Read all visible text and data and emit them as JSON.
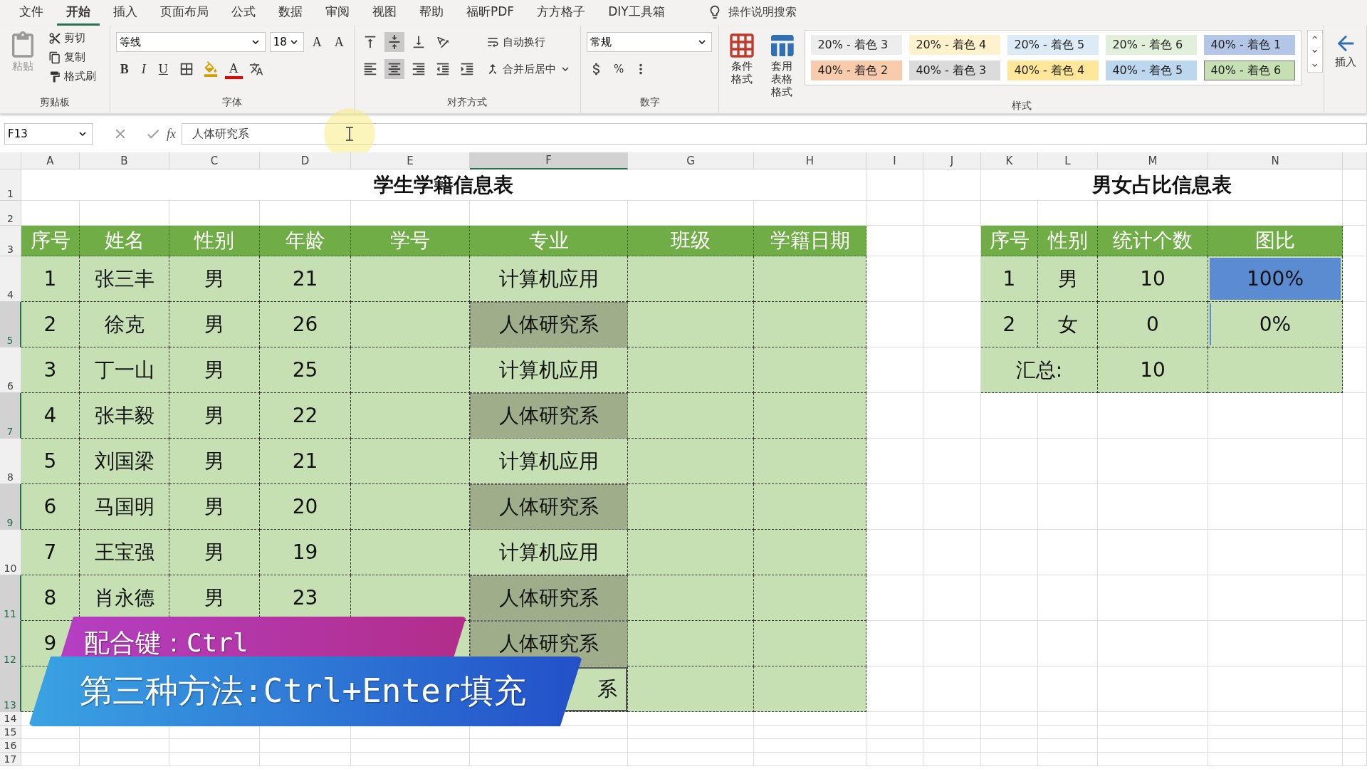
{
  "ribbon_tabs": [
    {
      "label": "文件",
      "selected": false
    },
    {
      "label": "开始",
      "selected": true
    },
    {
      "label": "插入",
      "selected": false
    },
    {
      "label": "页面布局",
      "selected": false
    },
    {
      "label": "公式",
      "selected": false
    },
    {
      "label": "数据",
      "selected": false
    },
    {
      "label": "审阅",
      "selected": false
    },
    {
      "label": "视图",
      "selected": false
    },
    {
      "label": "帮助",
      "selected": false
    },
    {
      "label": "福昕PDF",
      "selected": false
    },
    {
      "label": "方方格子",
      "selected": false
    },
    {
      "label": "DIY工具箱",
      "selected": false
    }
  ],
  "tell_me": "操作说明搜索",
  "clipboard": {
    "paste": "粘贴",
    "cut": "剪切",
    "copy": "复制",
    "format_painter": "格式刷",
    "group": "剪贴板"
  },
  "font": {
    "name": "等线",
    "size": "18",
    "grow": "A",
    "shrink": "A",
    "bold": "B",
    "italic": "I",
    "underline": "U",
    "font_color": "A",
    "group": "字体"
  },
  "alignment": {
    "wrap": "自动换行",
    "merge": "合并后居中",
    "group": "对齐方式"
  },
  "number": {
    "format": "常规",
    "percent": "%",
    "group": "数字"
  },
  "styles": {
    "conditional": "条件格式",
    "table_format_1": "套用",
    "table_format_2": "表格格式",
    "group": "样式",
    "gallery": [
      {
        "label": "20% - 着色 3",
        "color": "#ededed",
        "selected": false
      },
      {
        "label": "20% - 着色 4",
        "color": "#fff2cc",
        "selected": false
      },
      {
        "label": "20% - 着色 5",
        "color": "#ddebf7",
        "selected": false
      },
      {
        "label": "20% - 着色 6",
        "color": "#e2efda",
        "selected": false
      },
      {
        "label": "40% - 着色 1",
        "color": "#b4c6e7",
        "selected": false
      },
      {
        "label": "40% - 着色 2",
        "color": "#f8cbad",
        "selected": false
      },
      {
        "label": "40% - 着色 3",
        "color": "#dbdbdb",
        "selected": false
      },
      {
        "label": "40% - 着色 4",
        "color": "#ffe699",
        "selected": false
      },
      {
        "label": "40% - 着色 5",
        "color": "#bdd7ee",
        "selected": false
      },
      {
        "label": "40% - 着色 6",
        "color": "#c6e0b4",
        "selected": true
      }
    ]
  },
  "cells": {
    "insert": "插入"
  },
  "formula_bar": {
    "name_box": "F13",
    "fx": "fx",
    "formula": "人体研究系"
  },
  "columns": [
    {
      "label": "A",
      "selected": false
    },
    {
      "label": "B",
      "selected": false
    },
    {
      "label": "C",
      "selected": false
    },
    {
      "label": "D",
      "selected": false
    },
    {
      "label": "E",
      "selected": false
    },
    {
      "label": "F",
      "selected": true
    },
    {
      "label": "G",
      "selected": false
    },
    {
      "label": "H",
      "selected": false
    },
    {
      "label": "I",
      "selected": false
    },
    {
      "label": "J",
      "selected": false
    },
    {
      "label": "K",
      "selected": false
    },
    {
      "label": "L",
      "selected": false
    },
    {
      "label": "M",
      "selected": false
    },
    {
      "label": "N",
      "selected": false
    }
  ],
  "row_numbers": [
    {
      "label": "1",
      "selected": false
    },
    {
      "label": "2",
      "selected": false
    },
    {
      "label": "3",
      "selected": false
    },
    {
      "label": "4",
      "selected": false
    },
    {
      "label": "5",
      "selected": true
    },
    {
      "label": "6",
      "selected": false
    },
    {
      "label": "7",
      "selected": true
    },
    {
      "label": "8",
      "selected": false
    },
    {
      "label": "9",
      "selected": true
    },
    {
      "label": "10",
      "selected": false
    },
    {
      "label": "11",
      "selected": true
    },
    {
      "label": "12",
      "selected": true
    },
    {
      "label": "13",
      "selected": true
    },
    {
      "label": "14",
      "selected": false
    },
    {
      "label": "15",
      "selected": false
    },
    {
      "label": "16",
      "selected": false
    },
    {
      "label": "17",
      "selected": false
    }
  ],
  "student_table": {
    "title": "学生学籍信息表",
    "headers": [
      "序号",
      "姓名",
      "性别",
      "年龄",
      "学号",
      "专业",
      "班级",
      "学籍日期"
    ],
    "rows": [
      {
        "no": "1",
        "name": "张三丰",
        "gender": "男",
        "age": "21",
        "major": "计算机应用",
        "major_selected": false,
        "major_active": false
      },
      {
        "no": "2",
        "name": "徐克",
        "gender": "男",
        "age": "26",
        "major": "人体研究系",
        "major_selected": true,
        "major_active": false
      },
      {
        "no": "3",
        "name": "丁一山",
        "gender": "男",
        "age": "25",
        "major": "计算机应用",
        "major_selected": false,
        "major_active": false
      },
      {
        "no": "4",
        "name": "张丰毅",
        "gender": "男",
        "age": "22",
        "major": "人体研究系",
        "major_selected": true,
        "major_active": false
      },
      {
        "no": "5",
        "name": "刘国梁",
        "gender": "男",
        "age": "21",
        "major": "计算机应用",
        "major_selected": false,
        "major_active": false
      },
      {
        "no": "6",
        "name": "马国明",
        "gender": "男",
        "age": "20",
        "major": "人体研究系",
        "major_selected": true,
        "major_active": false
      },
      {
        "no": "7",
        "name": "王宝强",
        "gender": "男",
        "age": "19",
        "major": "计算机应用",
        "major_selected": false,
        "major_active": false
      },
      {
        "no": "8",
        "name": "肖永德",
        "gender": "男",
        "age": "23",
        "major": "人体研究系",
        "major_selected": true,
        "major_active": false
      },
      {
        "no": "9",
        "major": "人体研究系",
        "major_selected": true,
        "major_active": false
      },
      {
        "major": "系",
        "major_selected": false,
        "major_active": true
      }
    ]
  },
  "ratio_table": {
    "title": "男女占比信息表",
    "headers": [
      "序号",
      "性别",
      "统计个数",
      "图比"
    ],
    "rows": [
      {
        "no": "1",
        "gender": "男",
        "count": "10",
        "ratio": "100%",
        "level": 1
      },
      {
        "no": "2",
        "gender": "女",
        "count": "0",
        "ratio": "0%",
        "level": 0
      }
    ],
    "summary": {
      "label": "汇总:",
      "count": "10"
    }
  },
  "captions": [
    {
      "kind": "hint",
      "text": "配合键：Ctrl"
    },
    {
      "kind": "method",
      "text": "第三种方法:Ctrl+Enter填充"
    }
  ]
}
